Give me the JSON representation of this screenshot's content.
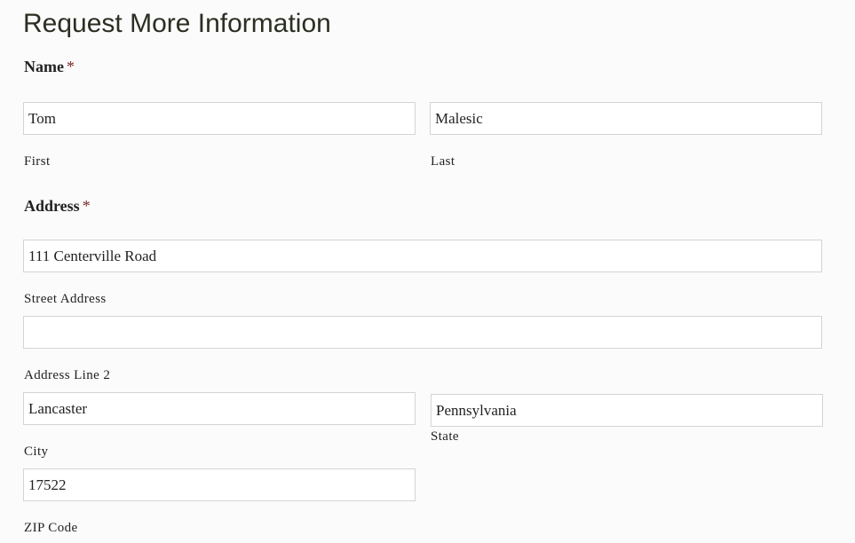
{
  "form": {
    "title": "Request More Information",
    "name_section": {
      "label": "Name",
      "required_marker": "*",
      "first": {
        "value": "Tom",
        "sublabel": "First"
      },
      "last": {
        "value": "Malesic",
        "sublabel": "Last"
      }
    },
    "address_section": {
      "label": "Address",
      "required_marker": "*",
      "street": {
        "value": "111 Centerville Road",
        "sublabel": "Street Address"
      },
      "line2": {
        "value": "",
        "sublabel": "Address Line 2"
      },
      "city": {
        "value": "Lancaster",
        "sublabel": "City"
      },
      "state": {
        "value": "Pennsylvania",
        "sublabel": "State"
      },
      "zip": {
        "value": "17522",
        "sublabel": "ZIP Code"
      }
    }
  },
  "colors": {
    "background": "#fbfbfb",
    "title": "#2b2f22",
    "field_border": "#d4d4d4",
    "required_marker": "#7a2a2a"
  }
}
